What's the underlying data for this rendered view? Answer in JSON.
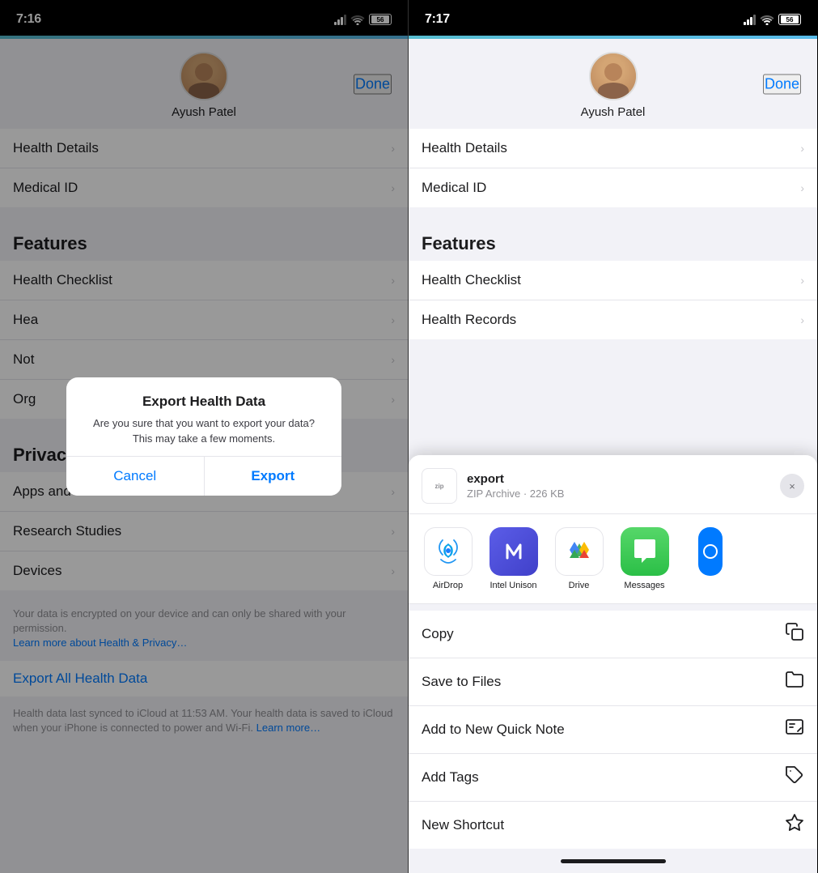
{
  "left_panel": {
    "status": {
      "time": "7:16",
      "battery": "56"
    },
    "profile": {
      "name": "Ayush Patel",
      "done_label": "Done"
    },
    "menu_items": [
      {
        "label": "Health Details",
        "has_chevron": true
      },
      {
        "label": "Medical ID",
        "has_chevron": true
      }
    ],
    "features_section": {
      "header": "Features",
      "items": [
        {
          "label": "Health Checklist",
          "has_chevron": true
        },
        {
          "label": "Health Records",
          "has_chevron": true
        },
        {
          "label": "Notifications",
          "has_chevron": true
        },
        {
          "label": "Organ & Tissue Donation",
          "has_chevron": true
        }
      ]
    },
    "privacy_section": {
      "header": "Privacy",
      "items": [
        {
          "label": "Apps and Services",
          "has_chevron": true
        },
        {
          "label": "Research Studies",
          "has_chevron": true
        },
        {
          "label": "Devices",
          "has_chevron": true
        }
      ],
      "footer_text": "Your data is encrypted on your device and can only be shared with your permission.",
      "footer_link": "Learn more about Health & Privacy…"
    },
    "export_link": "Export All Health Data",
    "export_footer": "Health data last synced to iCloud at 11:53 AM. Your health data is saved to iCloud when your iPhone is connected to power and Wi-Fi.",
    "export_footer_link": "Learn more…",
    "modal": {
      "title": "Export Health Data",
      "message": "Are you sure that you want to export your data? This may take a few moments.",
      "cancel_label": "Cancel",
      "export_label": "Export"
    }
  },
  "right_panel": {
    "status": {
      "time": "7:17",
      "battery": "56"
    },
    "profile": {
      "name": "Ayush Patel",
      "done_label": "Done"
    },
    "menu_items": [
      {
        "label": "Health Details",
        "has_chevron": true
      },
      {
        "label": "Medical ID",
        "has_chevron": true
      }
    ],
    "features_section": {
      "header": "Features",
      "items": [
        {
          "label": "Health Checklist",
          "has_chevron": true
        },
        {
          "label": "Health Records",
          "has_chevron": true
        }
      ]
    },
    "share_sheet": {
      "file_name": "export",
      "file_type": "ZIP Archive · 226 KB",
      "apps": [
        {
          "id": "airdrop",
          "label": "AirDrop"
        },
        {
          "id": "unison",
          "label": "Intel Unison"
        },
        {
          "id": "drive",
          "label": "Drive"
        },
        {
          "id": "messages",
          "label": "Messages"
        }
      ],
      "actions": [
        {
          "id": "copy",
          "label": "Copy",
          "icon": "copy"
        },
        {
          "id": "save-to-files",
          "label": "Save to Files",
          "icon": "folder"
        },
        {
          "id": "add-quick-note",
          "label": "Add to New Quick Note",
          "icon": "quick-note"
        },
        {
          "id": "add-tags",
          "label": "Add Tags",
          "icon": "tag"
        },
        {
          "id": "new-shortcut",
          "label": "New Shortcut",
          "icon": "shortcut"
        }
      ],
      "close_label": "×"
    }
  }
}
